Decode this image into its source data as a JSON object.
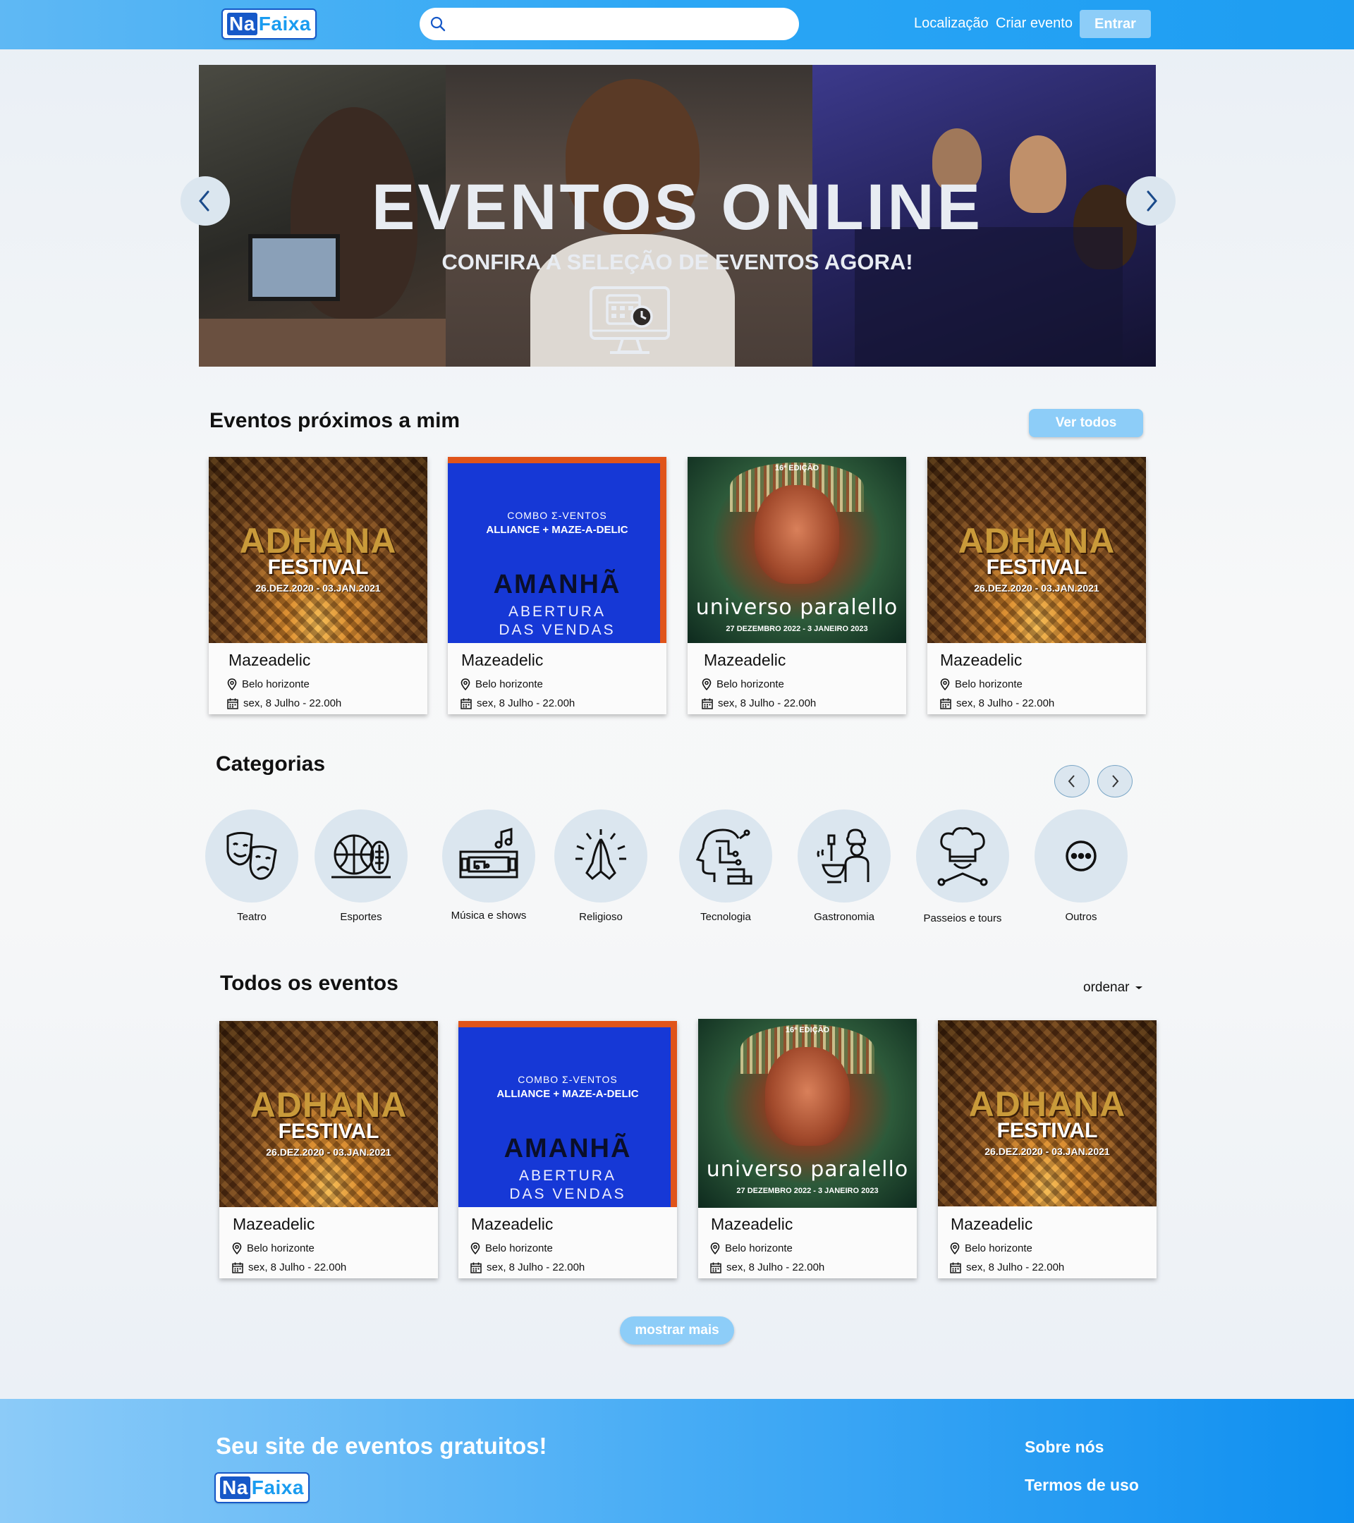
{
  "header": {
    "logo": {
      "na": "Na",
      "faixa": "Faixa"
    },
    "search": {
      "placeholder": "",
      "value": ""
    },
    "nav": {
      "location": "Localização",
      "create_event": "Criar evento",
      "login": "Entrar"
    }
  },
  "banner": {
    "title": "EVENTOS ONLINE",
    "subtitle": "CONFIRA A SELEÇÃO DE EVENTOS AGORA!"
  },
  "nearby": {
    "title": "Eventos próximos a mim",
    "see_all": "Ver todos",
    "events": [
      {
        "poster": "adhana",
        "name": "Mazeadelic",
        "location": "Belo horizonte",
        "date": "sex, 8 Julho - 22.00h"
      },
      {
        "poster": "maze",
        "name": "Mazeadelic",
        "location": "Belo horizonte",
        "date": "sex, 8 Julho - 22.00h"
      },
      {
        "poster": "universo",
        "name": "Mazeadelic",
        "location": "Belo horizonte",
        "date": "sex, 8 Julho - 22.00h"
      },
      {
        "poster": "adhana",
        "name": "Mazeadelic",
        "location": "Belo horizonte",
        "date": "sex, 8 Julho - 22.00h"
      }
    ]
  },
  "posters": {
    "adhana": {
      "title": "ADHANA",
      "subtitle": "FESTIVAL",
      "dates": "26.DEZ.2020 - 03.JAN.2021"
    },
    "maze": {
      "combo": "COMBO Σ-VENTOS",
      "lineup": "ALLIANCE + MAZE-A-DELIC",
      "headline": "AMANHÃ",
      "line1": "ABERTURA",
      "line2": "DAS VENDAS"
    },
    "universo": {
      "edition": "16ª EDIÇÃO",
      "title": "universo paralello",
      "dates": "27 DEZEMBRO 2022 - 3 JANEIRO 2023"
    }
  },
  "categories": {
    "title": "Categorias",
    "items": [
      {
        "label": "Teatro",
        "icon": "theater-masks-icon"
      },
      {
        "label": "Esportes",
        "icon": "sports-balls-icon"
      },
      {
        "label": "Música e shows",
        "icon": "music-stage-icon"
      },
      {
        "label": "Religioso",
        "icon": "praying-hands-icon"
      },
      {
        "label": "Tecnologia",
        "icon": "tech-head-icon"
      },
      {
        "label": "Gastronomia",
        "icon": "chef-cooking-icon"
      },
      {
        "label": "Passeios e tours",
        "icon": "chef-hat-icon"
      },
      {
        "label": "Outros",
        "icon": "more-dots-icon"
      }
    ]
  },
  "all_events": {
    "title": "Todos os eventos",
    "sort": "ordenar",
    "show_more": "mostrar mais",
    "events": [
      {
        "poster": "adhana",
        "name": "Mazeadelic",
        "location": "Belo horizonte",
        "date": "sex, 8 Julho - 22.00h"
      },
      {
        "poster": "maze",
        "name": "Mazeadelic",
        "location": "Belo horizonte",
        "date": "sex, 8 Julho - 22.00h"
      },
      {
        "poster": "universo",
        "name": "Mazeadelic",
        "location": "Belo horizonte",
        "date": "sex, 8 Julho - 22.00h"
      },
      {
        "poster": "adhana",
        "name": "Mazeadelic",
        "location": "Belo horizonte",
        "date": "sex, 8 Julho - 22.00h"
      }
    ]
  },
  "footer": {
    "tagline": "Seu site de eventos gratuitos!",
    "logo": {
      "na": "Na",
      "faixa": "Faixa"
    },
    "links": [
      "Sobre nós",
      "Termos de uso"
    ]
  },
  "colors": {
    "header": "#2ba6f5",
    "button": "#8dcdf8",
    "icon_circle": "#dbe6ef",
    "logo_blue": "#1658c8"
  }
}
